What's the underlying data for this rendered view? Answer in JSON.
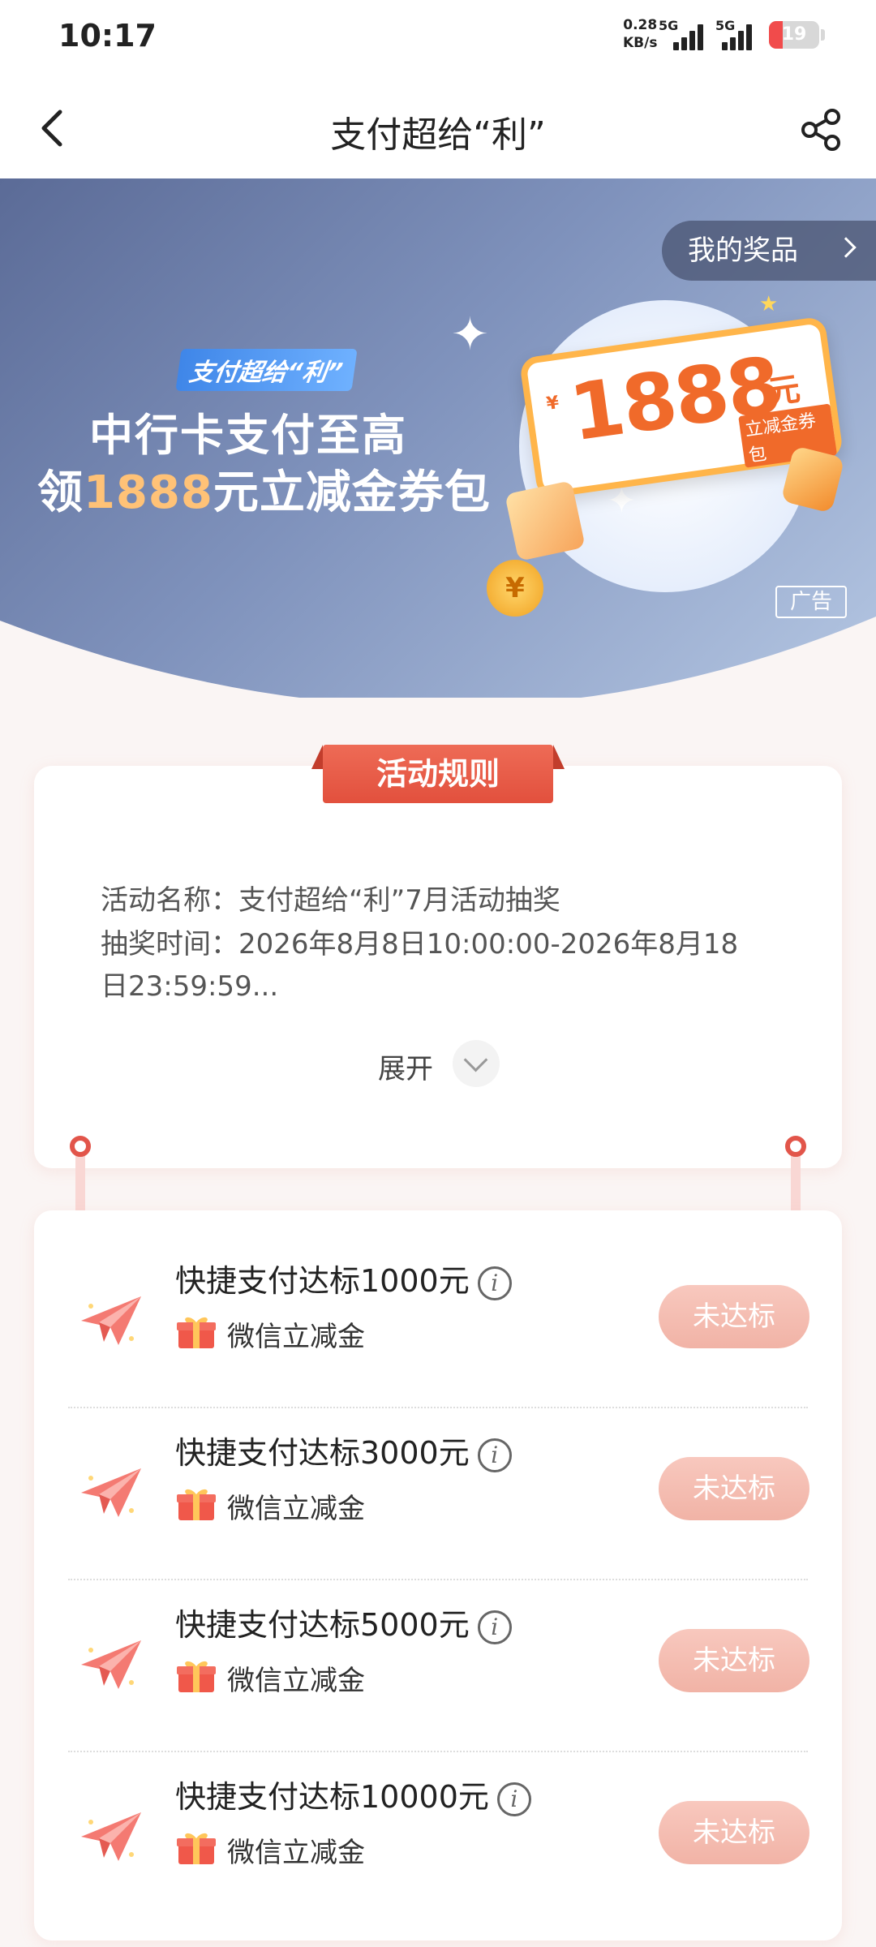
{
  "status_bar": {
    "time": "10:17",
    "net_speed": "0.28",
    "net_unit": "KB/s",
    "signal1_label": "5G",
    "signal2_label": "5G",
    "battery": "19",
    "battery_color": "#f14b4b"
  },
  "nav": {
    "title": "支付超给“利”",
    "back_icon": "chevron-left-icon",
    "share_icon": "share-icon"
  },
  "banner": {
    "my_prizes_label": "我的奖品",
    "brand_tag": "支付超给“利”",
    "headline_line1": "中行卡支付至高",
    "headline_line2_prefix": "领",
    "headline_line2_number": "1888",
    "headline_line2_suffix": "元立减金券包",
    "coupon_symbol": "¥",
    "coupon_amount": "1888",
    "coupon_unit": "元",
    "coupon_subtitle": "立减金券包",
    "coin_symbol": "¥",
    "ad_label": "广告"
  },
  "rules": {
    "ribbon_title": "活动规则",
    "activity_name": "活动名称：支付超给“利”7月活动抽奖",
    "draw_time_line1": "抽奖时间：2026年8月8日10:00:00-2026年8月18",
    "draw_time_line2": "日23:59:59...",
    "expand_label": "展开"
  },
  "tasks": [
    {
      "title": "快捷支付达标1000元",
      "reward": "微信立减金",
      "status": "未达标"
    },
    {
      "title": "快捷支付达标3000元",
      "reward": "微信立减金",
      "status": "未达标"
    },
    {
      "title": "快捷支付达标5000元",
      "reward": "微信立减金",
      "status": "未达标"
    },
    {
      "title": "快捷支付达标10000元",
      "reward": "微信立减金",
      "status": "未达标"
    }
  ],
  "colors": {
    "accent_red": "#e2503d",
    "status_button": "#f1b3a6",
    "banner_blue": "#7f92bc"
  }
}
